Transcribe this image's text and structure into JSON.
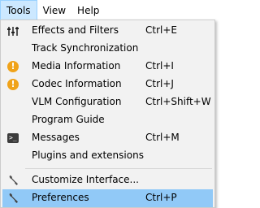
{
  "menubar": {
    "items": [
      {
        "label": "Tools"
      },
      {
        "label": "View"
      },
      {
        "label": "Help"
      }
    ]
  },
  "menu": {
    "items": [
      {
        "label": "Effects and Filters",
        "shortcut": "Ctrl+E",
        "icon": "sliders-icon"
      },
      {
        "label": "Track Synchronization",
        "shortcut": "",
        "icon": ""
      },
      {
        "label": "Media Information",
        "shortcut": "Ctrl+I",
        "icon": "info-icon"
      },
      {
        "label": "Codec Information",
        "shortcut": "Ctrl+J",
        "icon": "info-icon"
      },
      {
        "label": "VLM Configuration",
        "shortcut": "Ctrl+Shift+W",
        "icon": ""
      },
      {
        "label": "Program Guide",
        "shortcut": "",
        "icon": ""
      },
      {
        "label": "Messages",
        "shortcut": "Ctrl+M",
        "icon": "console-icon"
      },
      {
        "label": "Plugins and extensions",
        "shortcut": "",
        "icon": ""
      },
      {
        "label": "Customize Interface...",
        "shortcut": "",
        "icon": "wrench-icon"
      },
      {
        "label": "Preferences",
        "shortcut": "Ctrl+P",
        "icon": "wrench-icon"
      }
    ]
  },
  "colors": {
    "menu_background": "#f2f2f2",
    "highlight": "#91c9f7",
    "menubar_active": "#cce8ff",
    "info_icon": "#f0a31a"
  }
}
